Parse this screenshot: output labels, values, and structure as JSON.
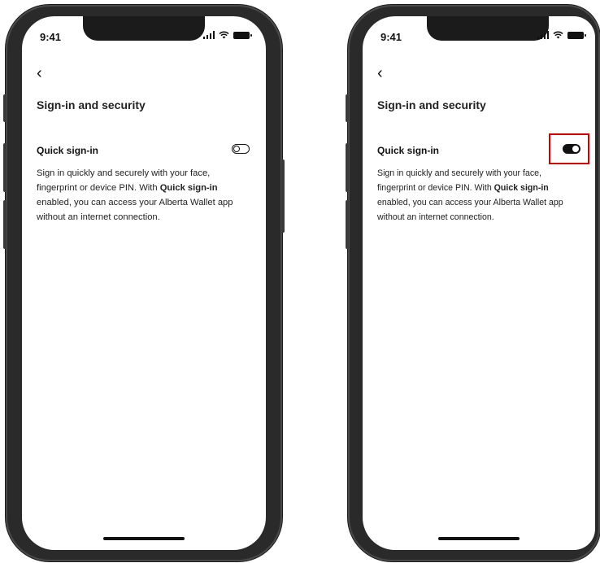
{
  "status_bar": {
    "time": "9:41"
  },
  "nav": {
    "back_icon": "chevron-left-icon",
    "back_glyph": "‹"
  },
  "page": {
    "title": "Sign-in and security"
  },
  "quick_signin": {
    "label": "Quick sign-in",
    "desc_part1": "Sign in quickly and securely with your face, fingerprint or device PIN. With ",
    "desc_bold": "Quick sign-in",
    "desc_part2": " enabled, you can access your Alberta Wallet app without an internet connection."
  },
  "screens": [
    {
      "toggle_state": "off"
    },
    {
      "toggle_state": "on",
      "highlight_color": "#d00000"
    }
  ]
}
